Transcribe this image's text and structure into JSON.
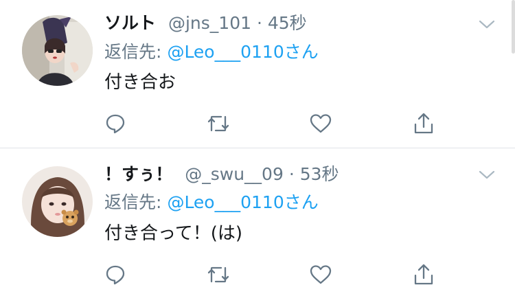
{
  "colors": {
    "text": "#14171a",
    "secondary": "#657786",
    "link": "#1da1f2",
    "divider": "#dfe3e7"
  },
  "tweets": [
    {
      "name": "ソルト",
      "handle": "@jns_101",
      "separator": "·",
      "time": "45秒",
      "reply_prefix": "返信先:",
      "reply_handle": "@Leo___0110",
      "reply_suffix": "さん",
      "text": "付き合お",
      "avatar_icon": "avatar-photo"
    },
    {
      "name": "！すぅ！",
      "handle": "@_swu__09",
      "separator": "·",
      "time": "53秒",
      "reply_prefix": "返信先:",
      "reply_handle": "@Leo___0110",
      "reply_suffix": "さん",
      "text": "付き合って！(は)",
      "avatar_icon": "avatar-photo"
    }
  ],
  "actions": {
    "reply_icon": "reply-icon",
    "retweet_icon": "retweet-icon",
    "like_icon": "like-icon",
    "share_icon": "share-icon",
    "menu_icon": "chevron-down-icon"
  }
}
